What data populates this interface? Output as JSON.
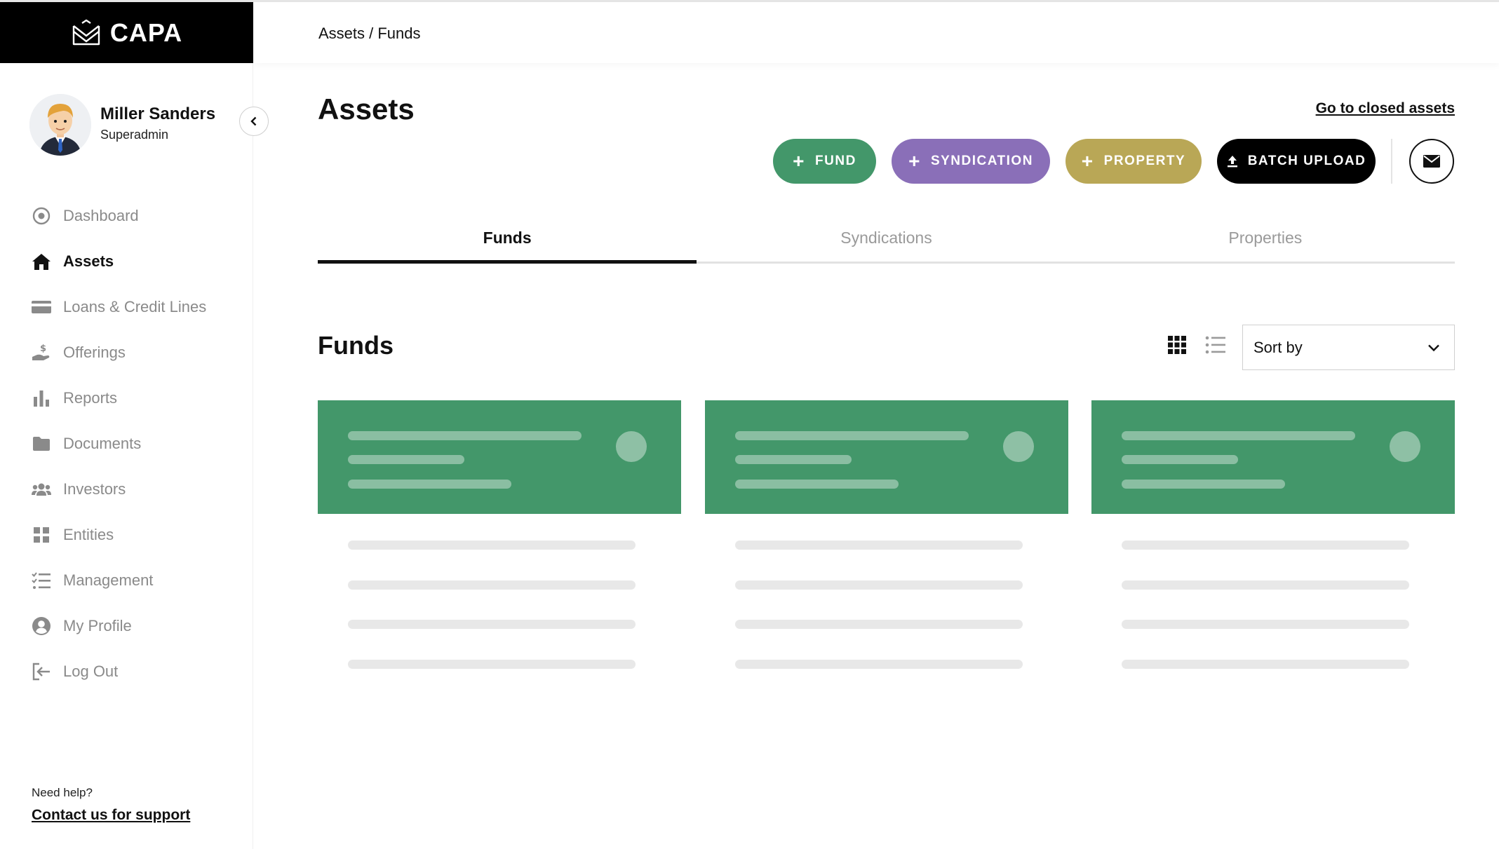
{
  "app": {
    "logo_text": "CAPA"
  },
  "user": {
    "name": "Miller Sanders",
    "role": "Superadmin"
  },
  "sidebar": {
    "items": [
      {
        "label": "Dashboard",
        "icon": "dashboard-icon"
      },
      {
        "label": "Assets",
        "icon": "home-icon",
        "active": true
      },
      {
        "label": "Loans & Credit Lines",
        "icon": "credit-card-icon"
      },
      {
        "label": "Offerings",
        "icon": "hand-dollar-icon"
      },
      {
        "label": "Reports",
        "icon": "bar-chart-icon"
      },
      {
        "label": "Documents",
        "icon": "folder-icon"
      },
      {
        "label": "Investors",
        "icon": "users-icon"
      },
      {
        "label": "Entities",
        "icon": "grid-icon"
      },
      {
        "label": "Management",
        "icon": "checklist-icon"
      },
      {
        "label": "My Profile",
        "icon": "user-circle-icon"
      },
      {
        "label": "Log Out",
        "icon": "logout-icon"
      }
    ],
    "help_text": "Need help?",
    "support_link": "Contact us for support"
  },
  "breadcrumb": "Assets / Funds",
  "page": {
    "title": "Assets",
    "closed_link": "Go to closed assets",
    "actions": {
      "fund": "FUND",
      "syndication": "SYNDICATION",
      "property": "PROPERTY",
      "batch_upload": "BATCH UPLOAD"
    },
    "tabs": [
      {
        "label": "Funds",
        "active": true
      },
      {
        "label": "Syndications",
        "active": false
      },
      {
        "label": "Properties",
        "active": false
      }
    ],
    "section_title": "Funds",
    "sort": {
      "label": "Sort by"
    }
  },
  "colors": {
    "fund": "#43976a",
    "syndication": "#8a6fb8",
    "property": "#b9a756",
    "batch": "#000000",
    "sidebar_header": "#000000"
  }
}
